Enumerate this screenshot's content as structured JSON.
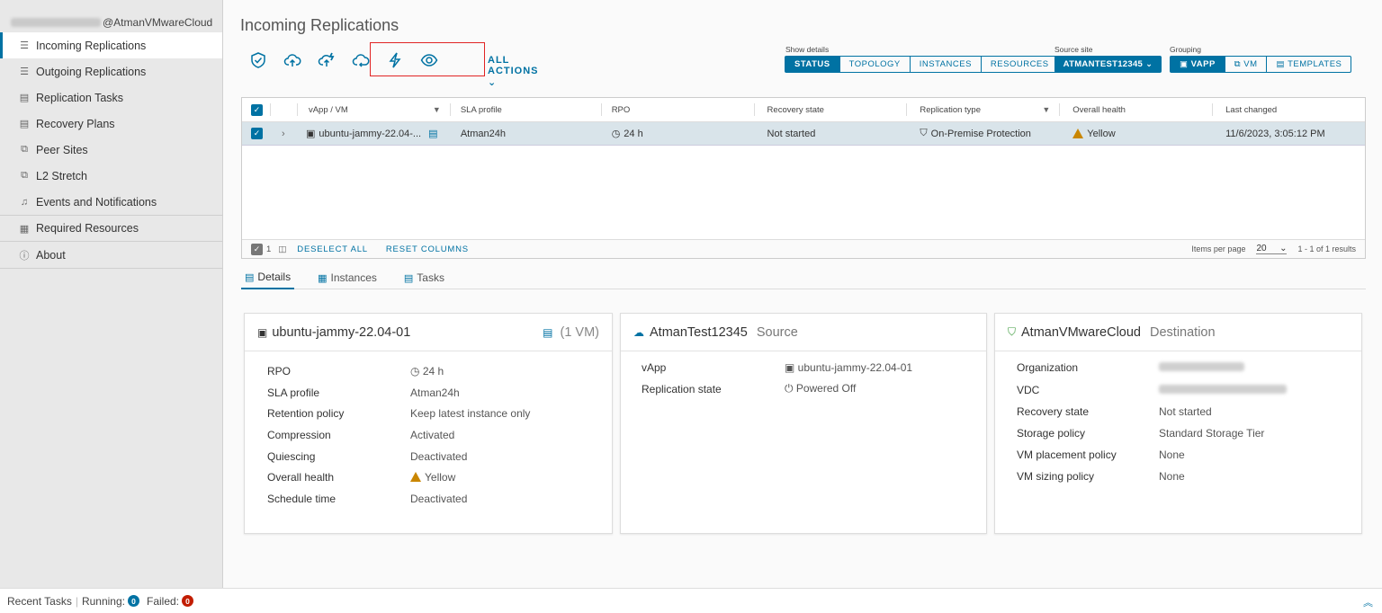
{
  "sidebar": {
    "user_suffix": "@AtmanVMwareCloud",
    "items": [
      {
        "label": "Incoming Replications",
        "icon": "list-icon"
      },
      {
        "label": "Outgoing Replications",
        "icon": "list-icon"
      },
      {
        "label": "Replication Tasks",
        "icon": "clipboard-icon"
      },
      {
        "label": "Recovery Plans",
        "icon": "clipboard-icon"
      },
      {
        "label": "Peer Sites",
        "icon": "network-icon"
      },
      {
        "label": "L2 Stretch",
        "icon": "network-icon"
      },
      {
        "label": "Events and Notifications",
        "icon": "bell-icon"
      },
      {
        "label": "Required Resources",
        "icon": "chart-icon"
      },
      {
        "label": "About",
        "icon": "info-icon"
      }
    ]
  },
  "page": {
    "title": "Incoming Replications",
    "all_actions": "ALL ACTIONS"
  },
  "view": {
    "show_details_label": "Show details",
    "show_details": [
      "STATUS",
      "TOPOLOGY",
      "INSTANCES",
      "RESOURCES"
    ],
    "source_site_label": "Source site",
    "source_site": "ATMANTEST12345",
    "grouping_label": "Grouping",
    "grouping": [
      "VAPP",
      "VM",
      "TEMPLATES"
    ]
  },
  "grid": {
    "columns": [
      "vApp / VM",
      "SLA profile",
      "RPO",
      "Recovery state",
      "Replication type",
      "Overall health",
      "Last changed"
    ],
    "row": {
      "name": "ubuntu-jammy-22.04-...",
      "sla": "Atman24h",
      "rpo": "24 h",
      "recovery_state": "Not started",
      "replication_type": "On-Premise Protection",
      "health": "Yellow",
      "last_changed": "11/6/2023, 3:05:12 PM"
    },
    "footer": {
      "selected_count": "1",
      "deselect_all": "DESELECT ALL",
      "reset_columns": "RESET COLUMNS",
      "items_per_page_label": "Items per page",
      "items_per_page": "20",
      "range": "1 - 1 of 1 results"
    }
  },
  "tabs": [
    "Details",
    "Instances",
    "Tasks"
  ],
  "card_vapp": {
    "title": "ubuntu-jammy-22.04-01",
    "vm_count": "(1 VM)",
    "rows": [
      {
        "k": "RPO",
        "v": "24 h"
      },
      {
        "k": "SLA profile",
        "v": "Atman24h"
      },
      {
        "k": "Retention policy",
        "v": "Keep latest instance only"
      },
      {
        "k": "Compression",
        "v": "Activated"
      },
      {
        "k": "Quiescing",
        "v": "Deactivated"
      },
      {
        "k": "Overall health",
        "v": "Yellow"
      },
      {
        "k": "Schedule time",
        "v": "Deactivated"
      }
    ]
  },
  "card_source": {
    "title": "AtmanTest12345",
    "role": "Source",
    "rows": [
      {
        "k": "vApp",
        "v": "ubuntu-jammy-22.04-01"
      },
      {
        "k": "Replication state",
        "v": "Powered Off"
      }
    ]
  },
  "card_dest": {
    "title": "AtmanVMwareCloud",
    "role": "Destination",
    "rows": [
      {
        "k": "Organization",
        "v": ""
      },
      {
        "k": "VDC",
        "v": ""
      },
      {
        "k": "Recovery state",
        "v": "Not started"
      },
      {
        "k": "Storage policy",
        "v": "Standard Storage Tier"
      },
      {
        "k": "VM placement policy",
        "v": "None"
      },
      {
        "k": "VM sizing policy",
        "v": "None"
      }
    ]
  },
  "bottom": {
    "recent_tasks": "Recent Tasks",
    "running_label": "Running:",
    "running_count": "0",
    "failed_label": "Failed:",
    "failed_count": "0"
  },
  "colors": {
    "accent": "#0072a3",
    "warning": "#c98600",
    "failed": "#c21d00",
    "highlight_box": "#e12424"
  }
}
